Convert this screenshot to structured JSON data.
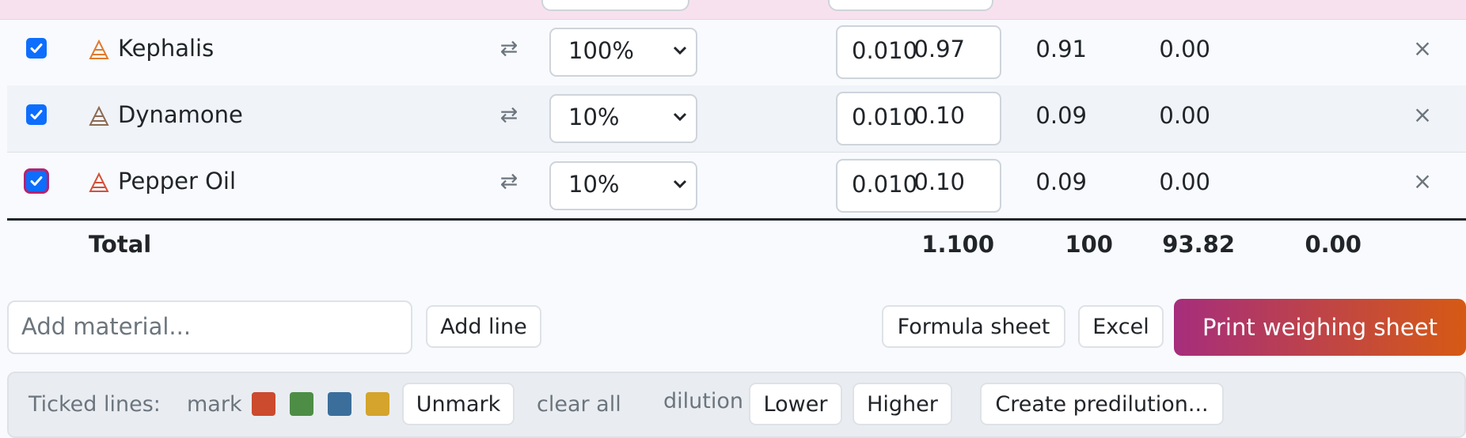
{
  "colors": {
    "accent": "#0d6efd",
    "print_gradient": [
      "#a62d7c",
      "#d65a14"
    ],
    "mark_swatches": [
      "#cc4a2e",
      "#4e8d46",
      "#3c6e9c",
      "#d4a42c"
    ]
  },
  "rows": [
    {
      "checked": true,
      "icon": "pyramid-orange-icon",
      "name": "Kephalis",
      "dilution": "100%",
      "amount": "0.010",
      "c1": "0.97",
      "c2": "0.91",
      "c3": "0.00"
    },
    {
      "checked": true,
      "icon": "pyramid-brown-icon",
      "name": "Dynamone",
      "dilution": "10%",
      "amount": "0.010",
      "c1": "0.10",
      "c2": "0.09",
      "c3": "0.00"
    },
    {
      "checked": true,
      "icon": "pyramid-red-icon",
      "name": "Pepper Oil",
      "dilution": "10%",
      "amount": "0.010",
      "c1": "0.10",
      "c2": "0.09",
      "c3": "0.00"
    }
  ],
  "swap_icon": "⇄",
  "delete_icon": "×",
  "total": {
    "label": "Total",
    "amount": "1.100",
    "c1": "100",
    "c2": "93.82",
    "c3": "0.00"
  },
  "add": {
    "placeholder": "Add material...",
    "add_line": "Add line"
  },
  "buttons": {
    "formula_sheet": "Formula sheet",
    "excel": "Excel",
    "print": "Print weighing sheet"
  },
  "ticked": {
    "label": "Ticked lines:",
    "mark": "mark",
    "unmark": "Unmark",
    "clear_all": "clear all",
    "dilution": "dilution",
    "lower": "Lower",
    "higher": "Higher",
    "predilution": "Create predilution..."
  }
}
